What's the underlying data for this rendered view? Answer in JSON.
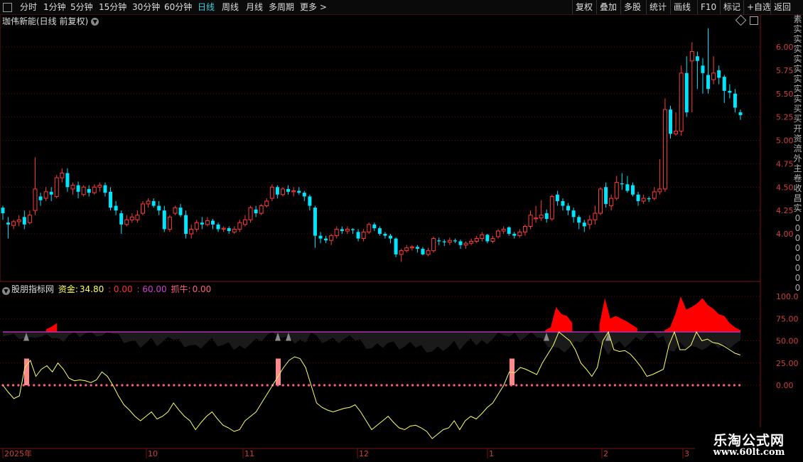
{
  "toolbar": {
    "periods": [
      "分时",
      "1分钟",
      "5分钟",
      "15分钟",
      "30分钟",
      "60分钟",
      "日线",
      "周线",
      "月线",
      "多周期",
      "更多 >"
    ],
    "active_period": "日线",
    "right_buttons": [
      "复权",
      "叠加",
      "多股",
      "统计",
      "画线",
      "F10",
      "标记",
      "+自选",
      "返回"
    ]
  },
  "main_chart": {
    "title": "珈伟新能(日线 前复权)",
    "price_labels": [
      "6.00",
      "5.75",
      "5.50",
      "5.25",
      "5.00",
      "4.75",
      "4.50",
      "4.25",
      "4.00"
    ]
  },
  "indicator": {
    "name": "股朋指标网",
    "fund_label": "资金:",
    "fund_value": "34.80",
    "v2": ": 0.00",
    "v3": ": 60.00",
    "grab_label": "抓牛:",
    "grab_value": "0.00",
    "axis_labels": [
      "100.0",
      "75.00",
      "50.00",
      "25.00",
      "0.00"
    ]
  },
  "time_axis": [
    "2025年",
    "10",
    "11",
    "12",
    "1",
    "2",
    "3"
  ],
  "right_side_chars": [
    "素",
    "实",
    "实",
    "实",
    "实",
    "实",
    "实",
    "实",
    "实",
    "买",
    "买",
    "开",
    "资",
    "流",
    "外",
    "主",
    "卷",
    "收",
    "昌",
    "实",
    "0",
    "0",
    "0",
    "0",
    "0",
    "0",
    "0",
    "0"
  ],
  "watermark": {
    "line1": "乐淘公式网",
    "line2": "www.60lt.com"
  },
  "colors": {
    "up": "#ff3b3b",
    "down": "#00e5ff",
    "fund_line": "#ffff66",
    "baseline": "#b030b0",
    "dots": "#ff6080",
    "red_area": "#ff0000"
  }
}
